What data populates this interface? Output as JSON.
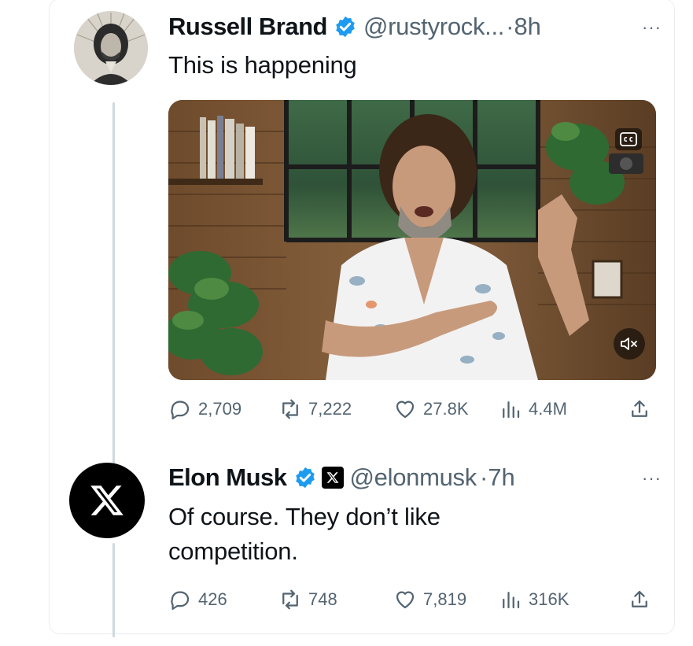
{
  "tweets": [
    {
      "name": "Russell Brand",
      "handle": "@rustyrock...",
      "time": "8h",
      "text": "This is happening",
      "verified": true,
      "avatar_icon": "russell-brand-avatar",
      "media_icons": [
        "captions-icon",
        "mute-icon"
      ],
      "stats": {
        "replies": "2,709",
        "reposts": "7,222",
        "likes": "27.8K",
        "views": "4.4M"
      }
    },
    {
      "name": "Elon Musk",
      "handle": "@elonmusk",
      "time": "7h",
      "text": "Of course. They don’t like competition.",
      "verified": true,
      "affiliate_badge": "x-logo-icon",
      "avatar_icon": "x-logo-icon",
      "stats": {
        "replies": "426",
        "reposts": "748",
        "likes": "7,819",
        "views": "316K"
      }
    }
  ],
  "more_label": "···",
  "separator": "·",
  "colors": {
    "verified_blue": "#1d9bf0",
    "muted_text": "#536471",
    "thread_line": "#cfd9de"
  }
}
